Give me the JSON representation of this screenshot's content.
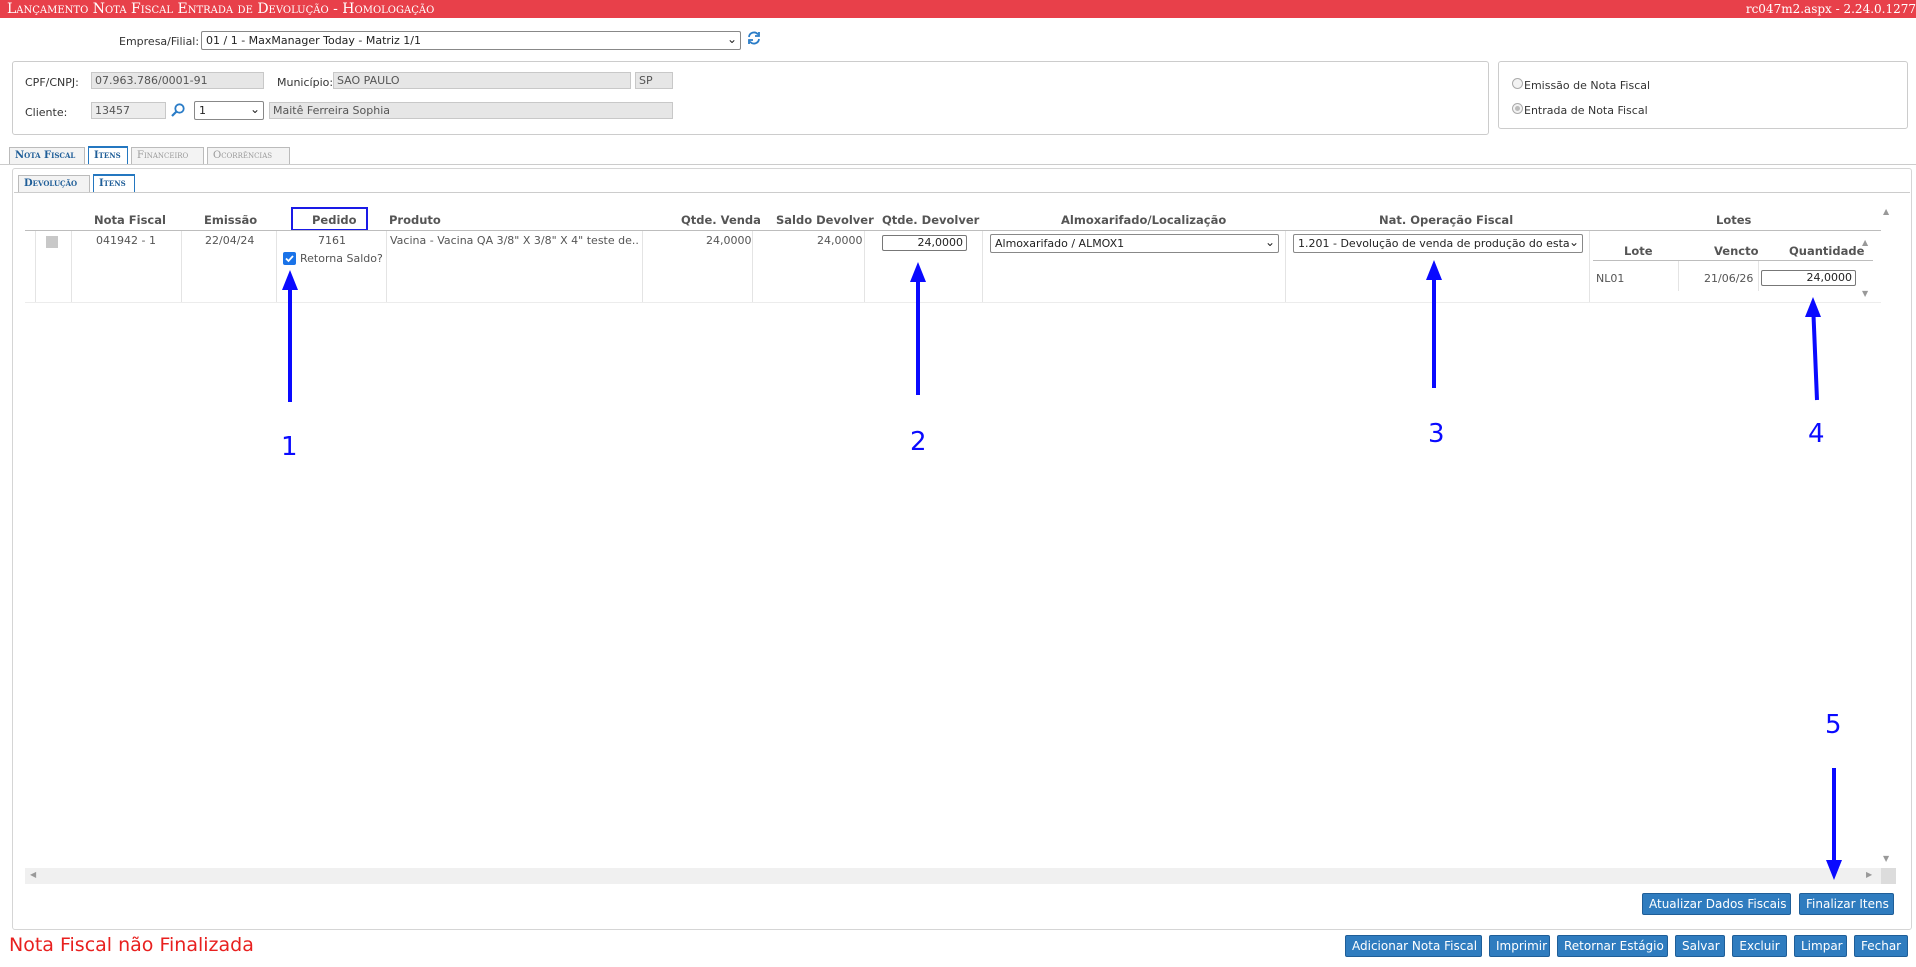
{
  "window": {
    "title": "Lançamento Nota Fiscal Entrada de Devolução  - Homologação",
    "version": "rc047m2.aspx - 2.24.0.1277"
  },
  "header": {
    "empresa_label": "Empresa/Filial:",
    "empresa_value": "01 / 1 - MaxManager Today - Matriz 1/1",
    "refresh_icon": "refresh-icon"
  },
  "client": {
    "cpf_label": "CPF/CNPJ:",
    "cpf_value": "07.963.786/0001-91",
    "municipio_label": "Município:",
    "municipio_value": "SAO PAULO",
    "uf_value": "SP",
    "cliente_label": "Cliente:",
    "cliente_code": "13457",
    "cliente_select": "1",
    "cliente_name": "Maitê Ferreira Sophia",
    "search_icon": "search-icon"
  },
  "mode": {
    "emissao_label": "Emissão de Nota Fiscal",
    "entrada_label": "Entrada de Nota Fiscal",
    "selected": "entrada"
  },
  "tabs": [
    {
      "label": "Nota Fiscal"
    },
    {
      "label": "Itens"
    },
    {
      "label": "Financeiro"
    },
    {
      "label": "Ocorrências"
    }
  ],
  "subtabs": [
    {
      "label": "Devolução"
    },
    {
      "label": "Itens"
    }
  ],
  "grid": {
    "columns": [
      "Nota Fiscal",
      "Emissão",
      "Pedido",
      "Produto",
      "Qtde. Venda",
      "Saldo Devolver",
      "Qtde. Devolver",
      "Almoxarifado/Localização",
      "Nat. Operação Fiscal",
      "Lotes"
    ],
    "row": {
      "nota_fiscal": "041942 - 1",
      "emissao": "22/04/24",
      "pedido": "7161",
      "retorna_saldo_label": "Retorna Saldo?",
      "retorna_saldo_checked": true,
      "produto": "Vacina - Vacina QA 3/8\" X 3/8\" X 4\" teste de...",
      "qtde_venda": "24,0000",
      "saldo_devolver": "24,0000",
      "qtde_devolver": "24,0000",
      "almoxarifado": "Almoxarifado / ALMOX1",
      "nat_operacao": "1.201 - Devolução de venda de produção do esta"
    },
    "lotes": {
      "columns": [
        "Lote",
        "Vencto",
        "Quantidade"
      ],
      "rows": [
        {
          "lote": "NL01",
          "vencto": "21/06/26",
          "quantidade": "24,0000"
        }
      ]
    }
  },
  "annotations": {
    "n1": "1",
    "n2": "2",
    "n3": "3",
    "n4": "4",
    "n5": "5",
    "color": "#0a0aff"
  },
  "actions": {
    "atualizar": "Atualizar Dados Fiscais",
    "finalizar": "Finalizar Itens"
  },
  "footer": {
    "status": "Nota Fiscal não Finalizada",
    "buttons": [
      "Adicionar Nota Fiscal",
      "Imprimir",
      "Retornar Estágio",
      "Salvar",
      "Excluir",
      "Limpar",
      "Fechar"
    ]
  },
  "colors": {
    "title_bar": "#e8404a",
    "button": "#2f7cbf",
    "status_text": "#e8201f",
    "tab_active": "#1f5e98"
  }
}
